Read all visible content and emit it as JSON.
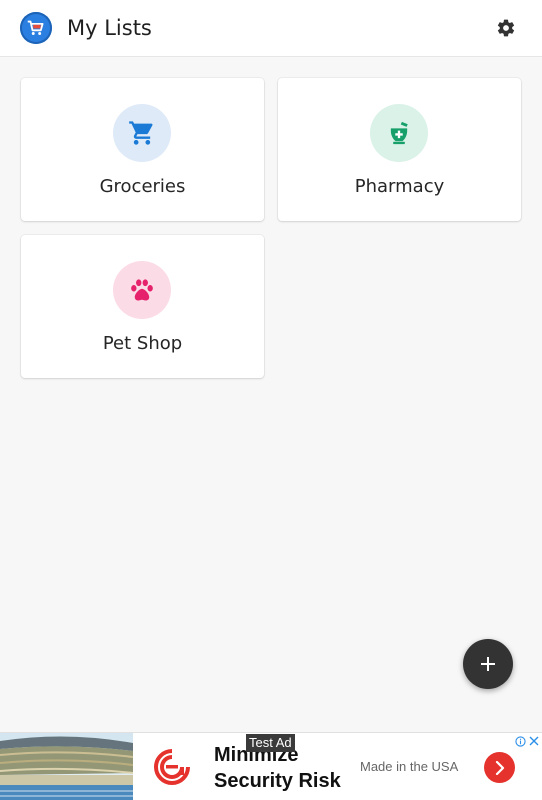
{
  "app": {
    "title": "My Lists",
    "logo_icon": "shopping-cart-logo-icon",
    "settings_icon": "gear-icon",
    "accent": "#2b7fe0"
  },
  "lists": [
    {
      "label": "Groceries",
      "icon": "shopping-cart-icon",
      "icon_color": "#1a7ad6",
      "bg_color": "#deeaf8"
    },
    {
      "label": "Pharmacy",
      "icon": "pharmacy-mortar-icon",
      "icon_color": "#17a06a",
      "bg_color": "#daf2e8"
    },
    {
      "label": "Pet Shop",
      "icon": "paw-icon",
      "icon_color": "#e5226b",
      "bg_color": "#fbdbe6"
    }
  ],
  "fab": {
    "icon": "plus-icon",
    "color": "#333333"
  },
  "ad": {
    "badge": "Test Ad",
    "headline": "Minimize Security Risk",
    "subtext": "Made in the USA",
    "cta_icon": "chevron-right-icon",
    "cta_color": "#e5322d",
    "info_icon": "info-icon",
    "close_icon": "close-icon"
  }
}
